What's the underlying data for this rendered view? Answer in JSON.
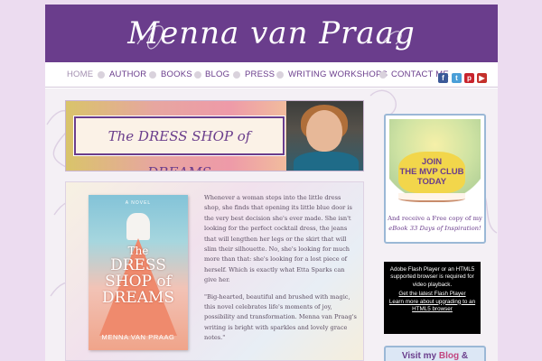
{
  "site": {
    "logo_text": "Menna van Praag"
  },
  "nav": {
    "items": [
      {
        "label": "HOME",
        "active": true
      },
      {
        "label": "AUTHOR"
      },
      {
        "label": "BOOKS"
      },
      {
        "label": "BLOG"
      },
      {
        "label": "PRESS"
      },
      {
        "label": "WRITING WORKSHOPS"
      },
      {
        "label": "CONTACT ME"
      }
    ]
  },
  "social": [
    {
      "icon": "facebook-icon",
      "glyph": "f",
      "color": "#3b5998"
    },
    {
      "icon": "twitter-icon",
      "glyph": "t",
      "color": "#4a9fd8"
    },
    {
      "icon": "pinterest-icon",
      "glyph": "p",
      "color": "#c8232c"
    },
    {
      "icon": "youtube-icon",
      "glyph": "▶",
      "color": "#c4302b"
    }
  ],
  "banner": {
    "title": "The DRESS SHOP of DREAMS"
  },
  "book": {
    "cover_kicker": "A NOVEL",
    "cover_title_1": "The",
    "cover_title_2": "DRESS",
    "cover_title_3": "SHOP of",
    "cover_title_4": "DREAMS",
    "cover_author": "MENNA VAN PRAAG",
    "paragraph_1": "Whenever a woman steps into the little dress shop, she finds that opening its little blue door is the very best decision she's ever made. She isn't looking for the perfect cocktail dress, the jeans that will lengthen her legs or the skirt that will slim their silhouette. No, she's looking for much more than that: she's looking for a lost piece of herself. Which is exactly what Etta Sparks can give her.",
    "paragraph_2": "\"Big-hearted, beautiful and brushed with magic, this novel celebrates life's moments of joy, possibility and transformation. Menna van Praag's writing is bright with sparkles and lovely grace notes.\""
  },
  "club": {
    "badge_1": "JOIN",
    "badge_2": "THE MVP CLUB",
    "badge_3": "TODAY",
    "text_1": "And receive a Free copy of my",
    "text_2": "eBook 33 Days of Inspiration!"
  },
  "flash": {
    "line_1": "Adobe Flash Player or an HTML5 supported browser is required for video playback.",
    "link_1": "Get the latest Flash Player",
    "link_2": "Learn more about upgrading to an HTML5 browser"
  },
  "visit": {
    "text_1": "Visit my",
    "text_2": "Blog",
    "text_3": "&"
  },
  "colors": {
    "brand_purple": "#6a3d8c",
    "page_background": "#ecdcf0",
    "widget_border": "#9bb8d6"
  }
}
